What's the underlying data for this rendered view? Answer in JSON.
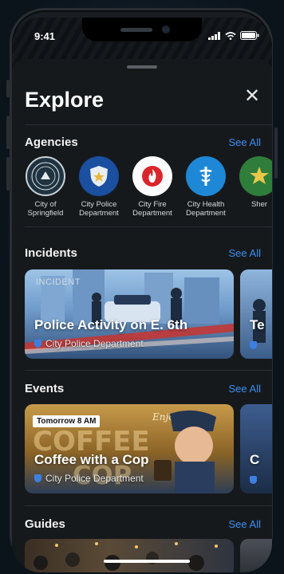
{
  "status": {
    "time": "9:41"
  },
  "header": {
    "title": "Explore",
    "close": "✕"
  },
  "agencies": {
    "label": "Agencies",
    "see_all": "See All",
    "items": [
      {
        "name": "City of Springfield",
        "color": "#1f3340",
        "icon": "city-seal-icon"
      },
      {
        "name": "City Police Department",
        "color": "#1b4fa0",
        "icon": "police-badge-icon"
      },
      {
        "name": "City Fire Department",
        "color": "#ffffff",
        "icon": "fire-icon"
      },
      {
        "name": "City Health Department",
        "color": "#1e88d6",
        "icon": "caduceus-icon"
      },
      {
        "name": "Sher",
        "color": "#2f7d3a",
        "icon": "sheriff-star-icon"
      }
    ]
  },
  "incidents": {
    "label": "Incidents",
    "see_all": "See All",
    "tag": "INCIDENT",
    "card": {
      "title": "Police Activity on E. 6th",
      "subtitle": "City Police Department"
    },
    "peek_title": "Te"
  },
  "events": {
    "label": "Events",
    "see_all": "See All",
    "card": {
      "badge": "Tomorrow 8 AM",
      "title": "Coffee with a Cop",
      "subtitle": "City Police Department",
      "art_text": "COFFEE",
      "art_text2": "COP",
      "enjoy": "Enjoy!"
    },
    "peek_title": "C"
  },
  "guides": {
    "label": "Guides",
    "see_all": "See All"
  }
}
